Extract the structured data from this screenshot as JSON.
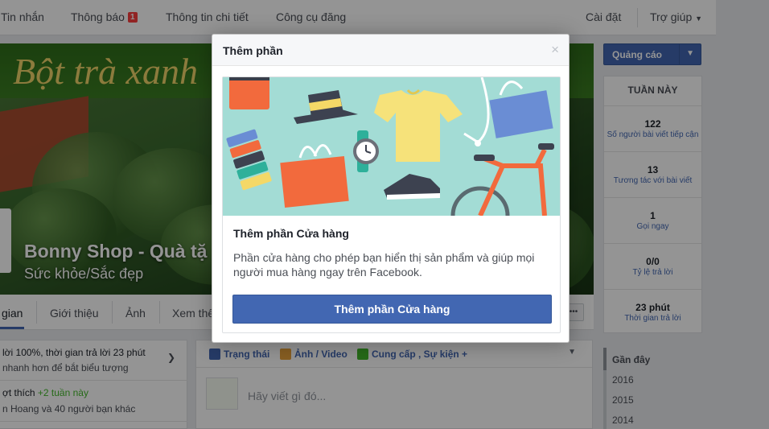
{
  "topnav": {
    "items": [
      "Tin nhắn",
      "Thông báo",
      "Thông tin chi tiết",
      "Công cụ đăng"
    ],
    "notification_count": "1",
    "settings": "Cài đặt",
    "help": "Trợ giúp"
  },
  "cover": {
    "banner_text": "Bột trà xanh",
    "page_name": "Bonny Shop - Quà tặ",
    "category": "Sức khỏe/Sắc đẹp"
  },
  "tabs": [
    "gian",
    "Giới thiệu",
    "Ảnh",
    "Xem thê"
  ],
  "left_card": {
    "line1": "lời 100%, thời gian trả lời 23 phút",
    "line2": "nhanh hơn để bắt biểu tượng",
    "line3_prefix": "ợt thích",
    "line3_highlight": "+2 tuần này",
    "line4": "n Hoang và 40 người bạn khác"
  },
  "composer": {
    "tools": [
      "Trạng thái",
      "Ảnh / Video",
      "Cung cấp , Sự kiện +"
    ],
    "placeholder": "Hãy viết gì đó..."
  },
  "ad_button": {
    "label": "Quảng cáo"
  },
  "stats": {
    "header": "TUẦN NÀY",
    "items": [
      {
        "value": "122",
        "label": "Số người bài viết tiếp cận"
      },
      {
        "value": "13",
        "label": "Tương tác với bài viết"
      },
      {
        "value": "1",
        "label": "Gọi ngay"
      },
      {
        "value": "0/0",
        "label": "Tỷ lệ trả lời"
      },
      {
        "value": "23 phút",
        "label": "Thời gian trả lời"
      }
    ]
  },
  "years": {
    "recent": "Gần đây",
    "list": [
      "2016",
      "2015",
      "2014"
    ]
  },
  "dialog": {
    "title": "Thêm phần",
    "close": "×",
    "card_title": "Thêm phần Cửa hàng",
    "description": "Phần cửa hàng cho phép bạn hiển thị sản phẩm và giúp mọi người mua hàng ngay trên Facebook.",
    "cta": "Thêm phần Cửa hàng"
  },
  "colors": {
    "accent": "#4267b2",
    "illustration_bg": "#a3dcd5",
    "badge": "#fa3e3e",
    "highlight": "#42b72a"
  }
}
